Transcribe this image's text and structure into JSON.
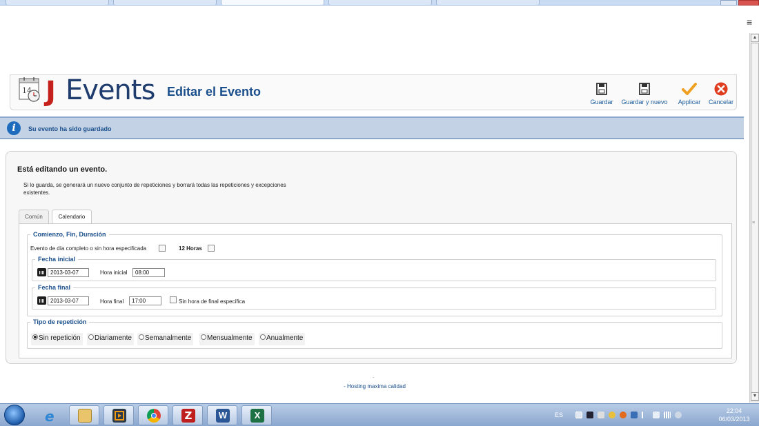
{
  "header": {
    "logo_j": "J",
    "logo_events": "Events",
    "logo_calendar_day": "14",
    "title": "Editar el Evento",
    "toolbar": {
      "save": "Guardar",
      "save_new": "Guardar y nuevo",
      "apply": "Applicar",
      "cancel": "Cancelar"
    }
  },
  "message": "Su evento ha sido guardado",
  "panel": {
    "title": "Está editando un evento.",
    "note": "Si lo guarda, se generará un nuevo conjunto de repeticiones y borrará todas las repeticiones y excepciones existentes.",
    "tabs": [
      {
        "label": "Común",
        "active": false
      },
      {
        "label": "Calendario",
        "active": true
      }
    ]
  },
  "form": {
    "section_start": "Comienzo, Fin, Duración",
    "allday_label": "Evento de día completo o sin hora especificada",
    "allday_checked": false,
    "twelve_hours_label": "12 Horas",
    "twelve_hours_checked": false,
    "start_legend": "Fecha inicial",
    "start_date": "2013-03-07",
    "start_time_label": "Hora inicial",
    "start_time": "08:00",
    "end_legend": "Fecha final",
    "end_date": "2013-03-07",
    "end_time_label": "Hora final",
    "end_time": "17:00",
    "no_end_label": "Sin hora de final específica",
    "no_end_checked": false,
    "repeat_legend": "Tipo de repetición",
    "repeat_options": [
      {
        "label": "Sin repetición",
        "selected": true
      },
      {
        "label": "Diariamente",
        "selected": false
      },
      {
        "label": "Semanalmente",
        "selected": false
      },
      {
        "label": "Mensualmente",
        "selected": false
      },
      {
        "label": "Anualmente",
        "selected": false
      }
    ]
  },
  "footer": {
    "dot": ".",
    "text": "- Hosting maxima calidad"
  },
  "taskbar": {
    "apps": [
      "internet-explorer-icon",
      "file-explorer-icon",
      "media-player-icon",
      "chrome-icon",
      "filezilla-icon",
      "word-icon",
      "excel-icon"
    ],
    "language": "ES",
    "time": "22:04",
    "date": "06/03/2013"
  },
  "colors": {
    "brand_red": "#c5201b",
    "brand_navy": "#1e3c6e",
    "link_blue": "#1a4f8c",
    "message_bg": "#c3d2e5",
    "apply_orange": "#f0a020",
    "cancel_red": "#e03c1f"
  }
}
